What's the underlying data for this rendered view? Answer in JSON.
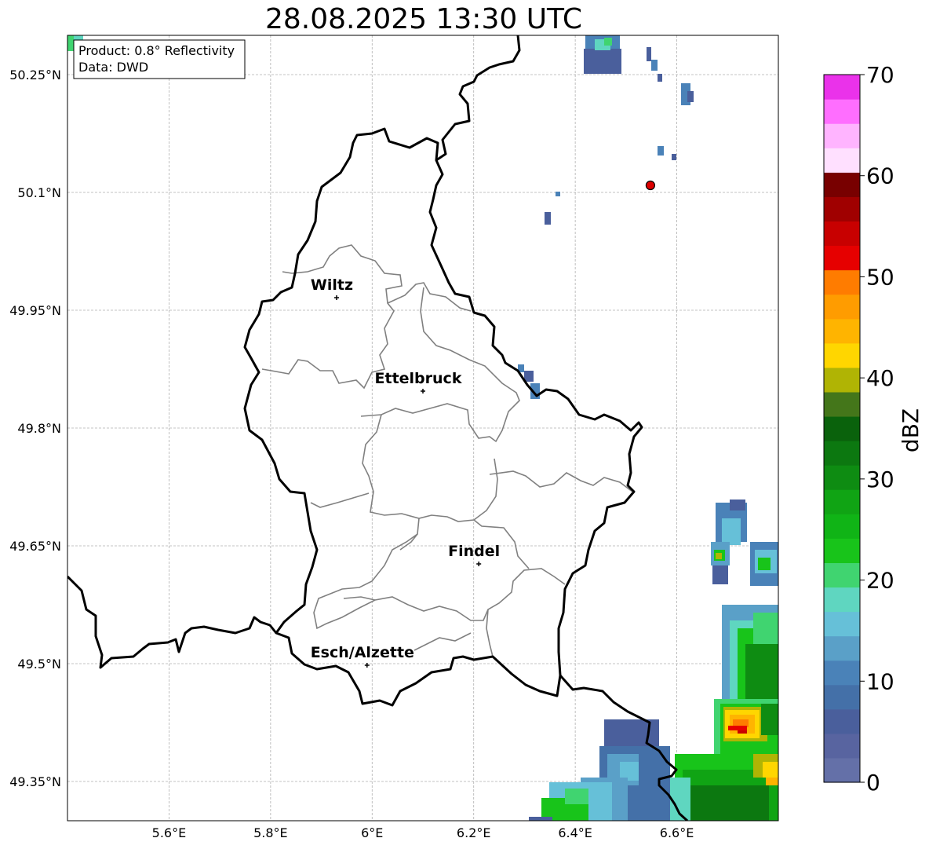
{
  "title": "28.08.2025 13:30 UTC",
  "info_box": {
    "product": "Product: 0.8° Reflectivity",
    "source": "Data: DWD"
  },
  "axes": {
    "lon_range": [
      5.4,
      6.8
    ],
    "lat_range": [
      49.3,
      50.3
    ],
    "lat_ticks": [
      {
        "value": 50.25,
        "label": "50.25°N"
      },
      {
        "value": 50.1,
        "label": "50.1°N"
      },
      {
        "value": 49.95,
        "label": "49.95°N"
      },
      {
        "value": 49.8,
        "label": "49.8°N"
      },
      {
        "value": 49.65,
        "label": "49.65°N"
      },
      {
        "value": 49.5,
        "label": "49.5°N"
      },
      {
        "value": 49.35,
        "label": "49.35°N"
      }
    ],
    "lon_ticks": [
      {
        "value": 5.6,
        "label": "5.6°E"
      },
      {
        "value": 5.8,
        "label": "5.8°E"
      },
      {
        "value": 6.0,
        "label": "6°E"
      },
      {
        "value": 6.2,
        "label": "6.2°E"
      },
      {
        "value": 6.4,
        "label": "6.4°E"
      },
      {
        "value": 6.6,
        "label": "6.6°E"
      }
    ],
    "grid": true
  },
  "cities": [
    {
      "name": "Wiltz",
      "lon": 5.93,
      "lat": 49.966
    },
    {
      "name": "Ettelbruck",
      "lon": 6.1,
      "lat": 49.847
    },
    {
      "name": "Findel",
      "lon": 6.21,
      "lat": 49.627
    },
    {
      "name": "Esch/Alzette",
      "lon": 5.99,
      "lat": 49.498
    }
  ],
  "radar_site": {
    "lon": 6.548,
    "lat": 50.109,
    "color": "#dd0000"
  },
  "colorbar": {
    "label": "dBZ",
    "min": 0,
    "max": 70,
    "tick_values": [
      0,
      10,
      20,
      30,
      40,
      50,
      60,
      70
    ],
    "tick_labels": [
      "0",
      "10",
      "20",
      "30",
      "40",
      "50",
      "60",
      "70"
    ],
    "colors": [
      "#6470a8",
      "#5864a0",
      "#4a5f9c",
      "#4470a8",
      "#4a82b8",
      "#5aa0c8",
      "#66c0d8",
      "#5fd6c0",
      "#40d470",
      "#18c41a",
      "#10b416",
      "#10a414",
      "#0e8c12",
      "#0c7810",
      "#0a620c",
      "#44761a",
      "#b0b404",
      "#ffd600",
      "#ffb400",
      "#ff9c00",
      "#ff7c00",
      "#e60000",
      "#c80000",
      "#a00000",
      "#780000",
      "#ffe0ff",
      "#ffb4ff",
      "#ff6eff",
      "#ea32ea"
    ]
  },
  "colors": {
    "border": "#000000",
    "cantons": "#808080",
    "grid": "#b0b0b0"
  }
}
